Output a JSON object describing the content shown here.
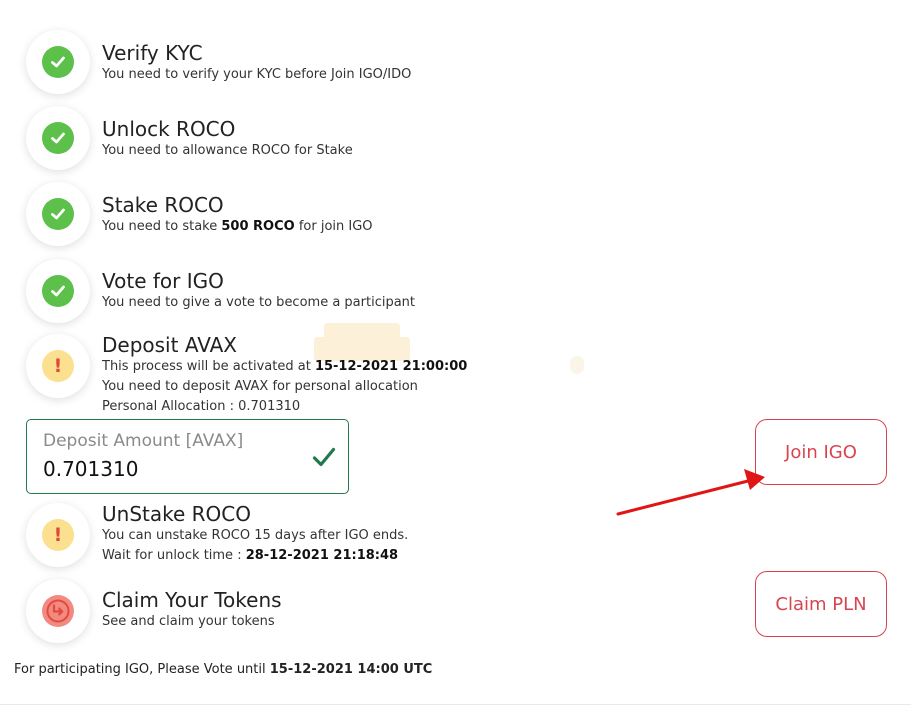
{
  "steps": [
    {
      "title": "Verify KYC",
      "lines": [
        "You need to verify your KYC before Join IGO/IDO"
      ],
      "status": "done"
    },
    {
      "title": "Unlock ROCO",
      "lines": [
        "You need to allowance ROCO for Stake"
      ],
      "status": "done"
    },
    {
      "title": "Stake ROCO",
      "line_pre": "You need to stake ",
      "line_bold": "500 ROCO",
      "line_post": " for join IGO",
      "status": "done"
    },
    {
      "title": "Vote for IGO",
      "lines": [
        "You need to give a vote to become a participant"
      ],
      "status": "done"
    },
    {
      "title": "Deposit AVAX",
      "activate_pre": "This process will be activated at ",
      "activate_date": "15-12-2021 21:00:00",
      "lines": [
        "You need to deposit AVAX for personal allocation",
        "Personal Allocation : 0.701310"
      ],
      "status": "warning"
    },
    {
      "title": "UnStake ROCO",
      "lines": [
        "You can unstake ROCO 15 days after IGO ends."
      ],
      "wait_pre": "Wait for unlock time : ",
      "wait_date": "28-12-2021 21:18:48",
      "status": "warning"
    },
    {
      "title": "Claim Your Tokens",
      "lines": [
        "See and claim your tokens"
      ],
      "status": "claim"
    }
  ],
  "deposit": {
    "label": "Deposit Amount [AVAX]",
    "value": "0.701310"
  },
  "buttons": {
    "join": "Join IGO",
    "claim": "Claim PLN"
  },
  "footer": {
    "pre": "For participating IGO, Please Vote until ",
    "date": "15-12-2021 14:00 UTC"
  },
  "colors": {
    "accent": "#d9454f",
    "done": "#5cc04a",
    "warning": "#fbe08f",
    "claim": "#f28a82",
    "input_border": "#1f7a4d",
    "arrow": "#e01515"
  },
  "icons": {
    "done": "check-icon",
    "warning": "exclamation-icon",
    "claim": "return-arrow-icon"
  }
}
